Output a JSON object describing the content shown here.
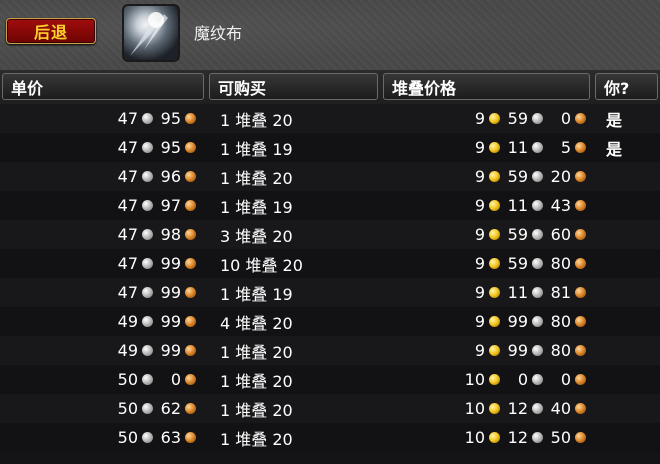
{
  "top": {
    "back_label": "后退",
    "item_name": "魔纹布"
  },
  "columns": {
    "unit_price": "单价",
    "available": "可购买",
    "stack_price": "堆叠价格",
    "you": "你?"
  },
  "rows": [
    {
      "unit_silver": "47",
      "unit_copper": "95",
      "available": "1 堆叠 20",
      "stack_gold": "9",
      "stack_silver": "59",
      "stack_copper": "0",
      "you": "是"
    },
    {
      "unit_silver": "47",
      "unit_copper": "95",
      "available": "1 堆叠 19",
      "stack_gold": "9",
      "stack_silver": "11",
      "stack_copper": "5",
      "you": "是"
    },
    {
      "unit_silver": "47",
      "unit_copper": "96",
      "available": "1 堆叠 20",
      "stack_gold": "9",
      "stack_silver": "59",
      "stack_copper": "20",
      "you": ""
    },
    {
      "unit_silver": "47",
      "unit_copper": "97",
      "available": "1 堆叠 19",
      "stack_gold": "9",
      "stack_silver": "11",
      "stack_copper": "43",
      "you": ""
    },
    {
      "unit_silver": "47",
      "unit_copper": "98",
      "available": "3 堆叠 20",
      "stack_gold": "9",
      "stack_silver": "59",
      "stack_copper": "60",
      "you": ""
    },
    {
      "unit_silver": "47",
      "unit_copper": "99",
      "available": "10 堆叠 20",
      "stack_gold": "9",
      "stack_silver": "59",
      "stack_copper": "80",
      "you": ""
    },
    {
      "unit_silver": "47",
      "unit_copper": "99",
      "available": "1 堆叠 19",
      "stack_gold": "9",
      "stack_silver": "11",
      "stack_copper": "81",
      "you": ""
    },
    {
      "unit_silver": "49",
      "unit_copper": "99",
      "available": "4 堆叠 20",
      "stack_gold": "9",
      "stack_silver": "99",
      "stack_copper": "80",
      "you": ""
    },
    {
      "unit_silver": "49",
      "unit_copper": "99",
      "available": "1 堆叠 20",
      "stack_gold": "9",
      "stack_silver": "99",
      "stack_copper": "80",
      "you": ""
    },
    {
      "unit_silver": "50",
      "unit_copper": "0",
      "available": "1 堆叠 20",
      "stack_gold": "10",
      "stack_silver": "0",
      "stack_copper": "0",
      "you": ""
    },
    {
      "unit_silver": "50",
      "unit_copper": "62",
      "available": "1 堆叠 20",
      "stack_gold": "10",
      "stack_silver": "12",
      "stack_copper": "40",
      "you": ""
    },
    {
      "unit_silver": "50",
      "unit_copper": "63",
      "available": "1 堆叠 20",
      "stack_gold": "10",
      "stack_silver": "12",
      "stack_copper": "50",
      "you": ""
    }
  ],
  "icons": {
    "item": "spellcloth-item-icon",
    "silver": "silver-coin-icon",
    "copper": "copper-coin-icon",
    "gold": "gold-coin-icon"
  },
  "colors": {
    "back_button_text": "#ffd22a",
    "back_button_bg": "#8a0808",
    "gold_coin": "#f2c21a",
    "silver_coin": "#bdbdbd",
    "copper_coin": "#d98326"
  }
}
